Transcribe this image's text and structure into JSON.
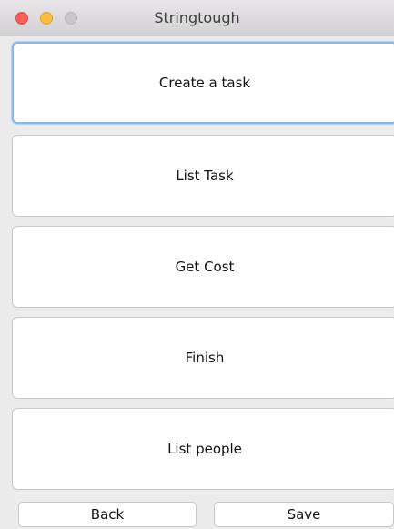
{
  "window": {
    "title": "Stringtough"
  },
  "menu": {
    "buttons": [
      {
        "label": "Create a task"
      },
      {
        "label": "List Task"
      },
      {
        "label": "Get Cost"
      },
      {
        "label": "Finish"
      },
      {
        "label": "List people"
      }
    ]
  },
  "footer": {
    "back_label": "Back",
    "save_label": "Save"
  },
  "colors": {
    "close": "#fc605c",
    "minimize": "#fdbc40",
    "zoom_disabled": "#c9c7c9",
    "focus_ring": "#8fb7e6"
  }
}
